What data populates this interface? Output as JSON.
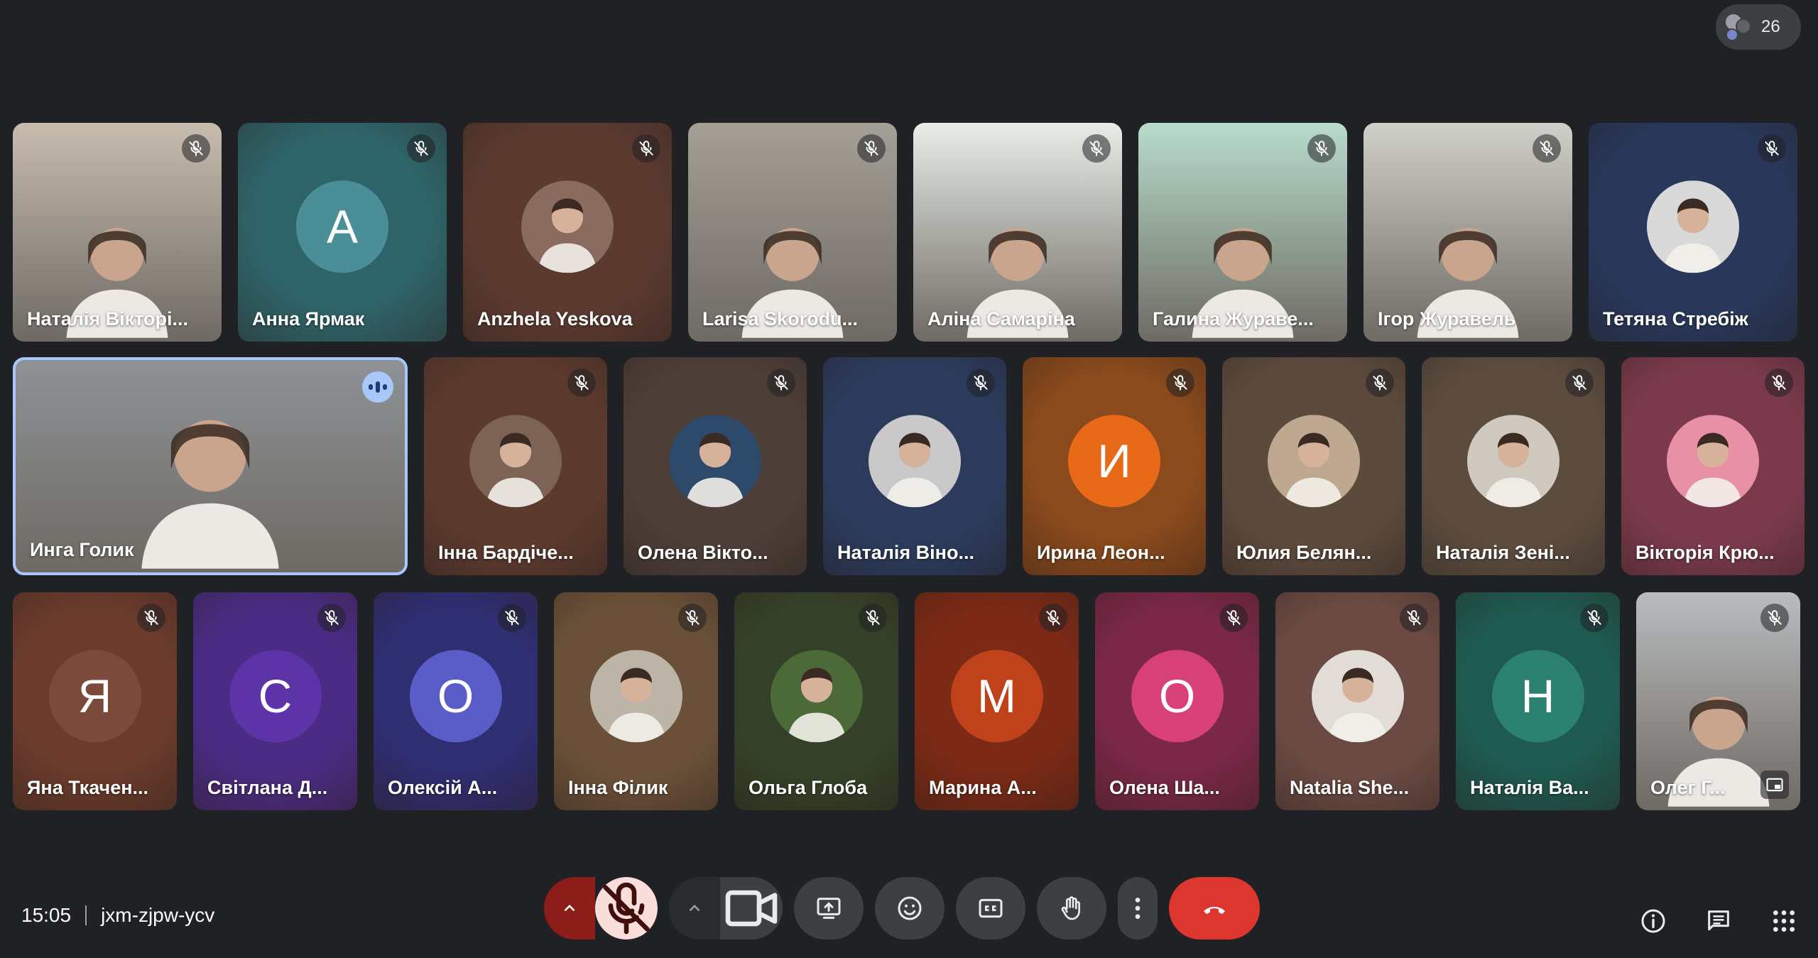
{
  "participant_count": "26",
  "rows": [
    [
      {
        "name": "Наталія Вікторі...",
        "kind": "video",
        "bg": "#c7bcae",
        "mic": "muted"
      },
      {
        "name": "Анна Ярмак",
        "kind": "letter",
        "letter": "А",
        "bg": "#2e6469",
        "circle": "#4a8f98",
        "mic": "muted"
      },
      {
        "name": "Anzhela Yeskova",
        "kind": "photo",
        "bg": "#5b3a30",
        "photo": "#8a6b60",
        "mic": "muted"
      },
      {
        "name": "Larisa Skorodu...",
        "kind": "video",
        "bg": "#a4a097",
        "mic": "muted"
      },
      {
        "name": "Аліна Самаріна",
        "kind": "video",
        "bg": "#e8ede8",
        "mic": "muted"
      },
      {
        "name": "Галина Жураве...",
        "kind": "video",
        "bg": "#b8dccb",
        "mic": "muted"
      },
      {
        "name": "Ігор Журавель",
        "kind": "video",
        "bg": "#cfd0c9",
        "mic": "muted"
      },
      {
        "name": "Тетяна Стребіж",
        "kind": "photo",
        "bg": "#29385a",
        "photo": "#d9d9d9",
        "mic": "muted"
      }
    ],
    [
      {
        "name": "Инга Голик",
        "kind": "video",
        "bg": "#8e9296",
        "mic": "speaking",
        "big": true
      },
      {
        "name": "Інна Бардіче...",
        "kind": "photo",
        "bg": "#5c3a2e",
        "photo": "#7d6256",
        "mic": "muted"
      },
      {
        "name": "Олена Вікто...",
        "kind": "photo",
        "bg": "#4d3e38",
        "photo": "#2d4a6a",
        "mic": "muted"
      },
      {
        "name": "Наталія Віно...",
        "kind": "photo",
        "bg": "#2c3b5c",
        "photo": "#c9c9c9",
        "mic": "muted"
      },
      {
        "name": "Ирина Леон...",
        "kind": "letter",
        "letter": "И",
        "bg": "#8a4a1c",
        "circle": "#e86a19",
        "mic": "muted"
      },
      {
        "name": "Юлия Белян...",
        "kind": "photo",
        "bg": "#5c4a3c",
        "photo": "#bfa890",
        "mic": "muted"
      },
      {
        "name": "Наталія Зені...",
        "kind": "photo",
        "bg": "#5c4c3e",
        "photo": "#cfc9c0",
        "mic": "muted"
      },
      {
        "name": "Вікторія Крю...",
        "kind": "photo",
        "bg": "#7a3a4c",
        "photo": "#e790a6",
        "mic": "muted"
      }
    ],
    [
      {
        "name": "Яна Ткачен...",
        "kind": "letter",
        "letter": "Я",
        "bg": "#6b3c2c",
        "circle": "#7c4a3a",
        "mic": "muted"
      },
      {
        "name": "Світлана Д...",
        "kind": "letter",
        "letter": "С",
        "bg": "#4a2c84",
        "circle": "#5d33a8",
        "mic": "muted"
      },
      {
        "name": "Олексій А...",
        "kind": "letter",
        "letter": "О",
        "bg": "#2f2e72",
        "circle": "#5a5cc8",
        "mic": "muted"
      },
      {
        "name": "Інна Філик",
        "kind": "photo",
        "bg": "#6a5038",
        "photo": "#bcb4a6",
        "mic": "muted"
      },
      {
        "name": "Ольга Глоба",
        "kind": "photo",
        "bg": "#354028",
        "photo": "#4c6a38",
        "mic": "muted"
      },
      {
        "name": "Марина А...",
        "kind": "letter",
        "letter": "М",
        "bg": "#7c2a16",
        "circle": "#c0421a",
        "mic": "muted"
      },
      {
        "name": "Олена Ша...",
        "kind": "letter",
        "letter": "О",
        "bg": "#7a2846",
        "circle": "#d84078",
        "mic": "muted"
      },
      {
        "name": "Natalia She...",
        "kind": "photo",
        "bg": "#6a4a42",
        "photo": "#e2dcd6",
        "mic": "muted"
      },
      {
        "name": "Наталія Ва...",
        "kind": "letter",
        "letter": "Н",
        "bg": "#1e5a50",
        "circle": "#2c8070",
        "mic": "muted"
      },
      {
        "name": "Олег Г...",
        "kind": "video",
        "bg": "#b9bcbe",
        "mic": "muted",
        "pin": true
      }
    ]
  ],
  "meeting": {
    "time": "15:05",
    "code": "jxm-zjpw-ycv"
  },
  "icons": {
    "mic_off": "mic-off-icon",
    "camera": "camera-icon",
    "present": "present-screen-icon",
    "emoji": "emoji-icon",
    "captions": "captions-icon",
    "hand": "raise-hand-icon",
    "more": "more-options-icon",
    "end": "end-call-icon",
    "info": "info-icon",
    "chat": "chat-icon",
    "activities": "activities-icon"
  },
  "colors": {
    "mic_active_bg": "#f9dedc",
    "mic_caret_bg": "#8c1d18",
    "end_call": "#dc362e",
    "speaking_border": "#a8c7fa"
  }
}
